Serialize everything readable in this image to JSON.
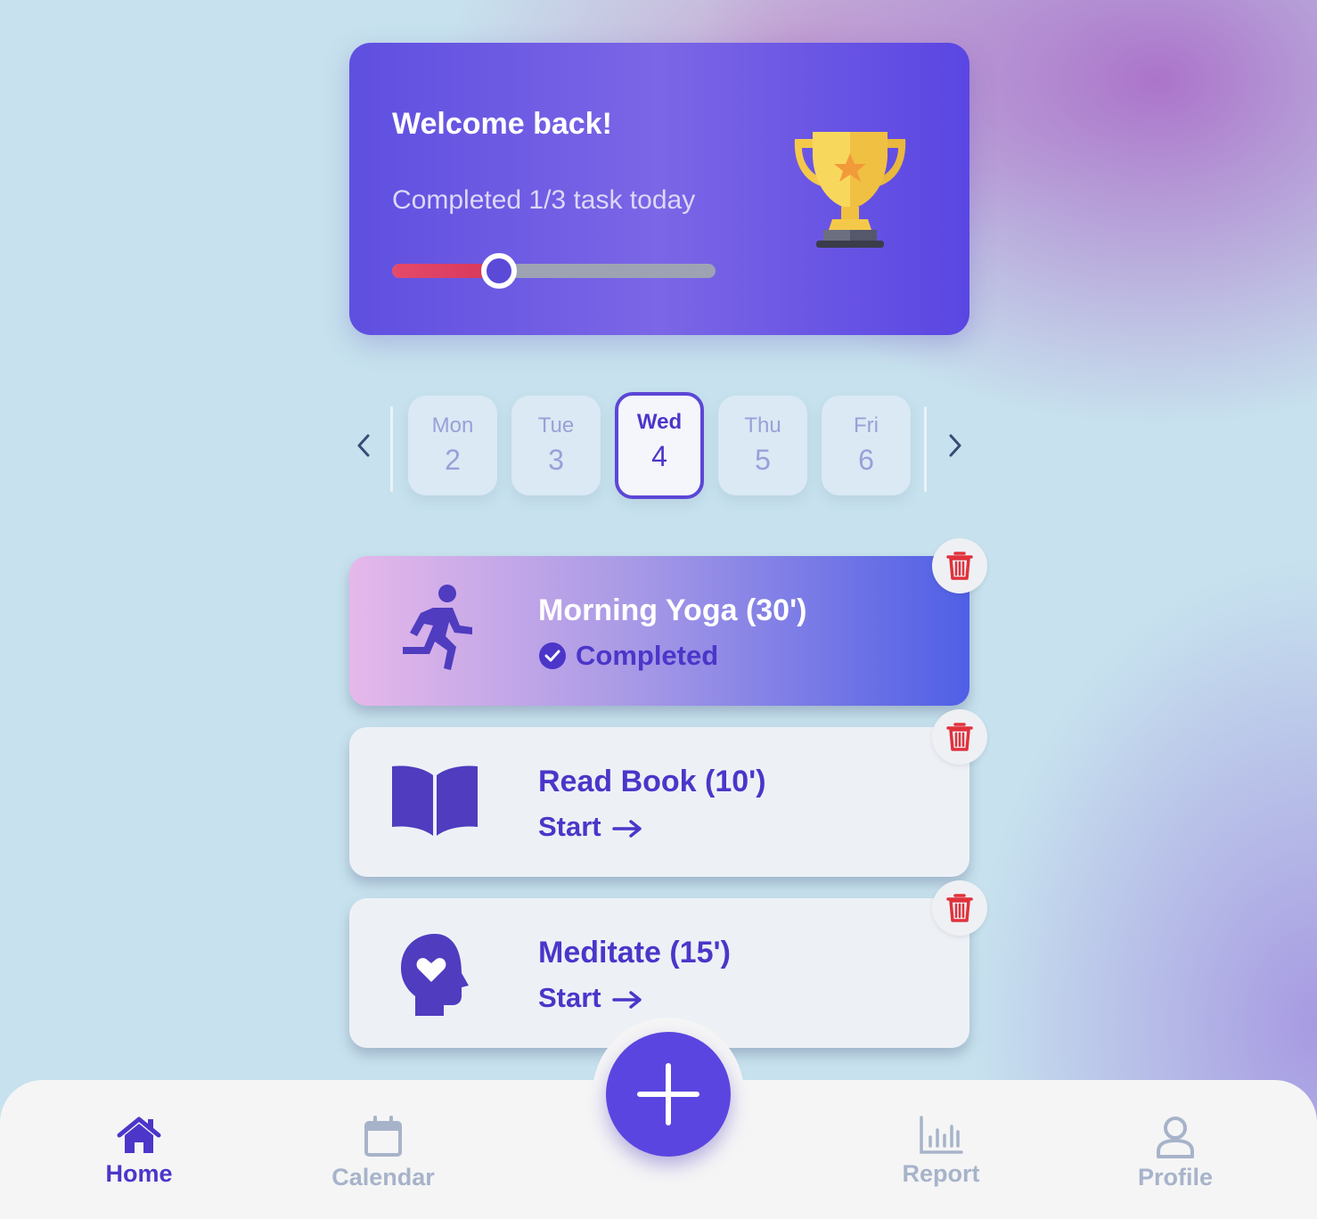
{
  "welcome": {
    "title": "Welcome back!",
    "subtitle": "Completed 1/3 task today",
    "progress": 0.33,
    "icon": "trophy-icon"
  },
  "days": [
    {
      "name": "Mon",
      "num": "2"
    },
    {
      "name": "Tue",
      "num": "3"
    },
    {
      "name": "Wed",
      "num": "4",
      "active": true
    },
    {
      "name": "Thu",
      "num": "5"
    },
    {
      "name": "Fri",
      "num": "6"
    }
  ],
  "tasks": [
    {
      "title": "Morning Yoga (30')",
      "status": "Completed",
      "icon": "running-icon",
      "done": true
    },
    {
      "title": "Read Book (10')",
      "status": "Start",
      "icon": "book-icon",
      "done": false
    },
    {
      "title": "Meditate (15')",
      "status": "Start",
      "icon": "mind-heart-icon",
      "done": false
    }
  ],
  "nav": {
    "home": "Home",
    "calendar": "Calendar",
    "report": "Report",
    "profile": "Profile"
  },
  "colors": {
    "accent": "#4b36c9",
    "progress_fill": "#e54a6a",
    "delete": "#e0323c"
  }
}
